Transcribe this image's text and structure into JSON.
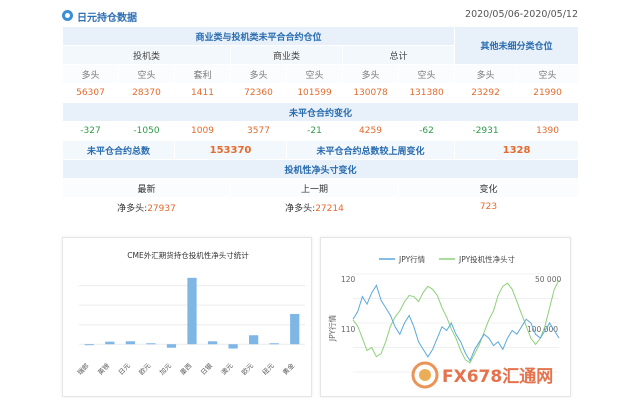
{
  "header": {
    "title": "日元持仓数据",
    "date_range": "2020/05/06-2020/05/12"
  },
  "table": {
    "main_header": "商业类与投机类未平合合约仓位",
    "other_header": "其他未细分类仓位",
    "group_spec": "投机类",
    "group_comm": "商业类",
    "group_total": "总计",
    "col_long": "多头",
    "col_short": "空头",
    "col_spread": "套利",
    "row1": [
      "56307",
      "28370",
      "1411",
      "72360",
      "101599",
      "130078",
      "131380",
      "23292",
      "21990"
    ],
    "change_header": "未平仓合约变化",
    "row2": [
      "-327",
      "-1050",
      "1009",
      "3577",
      "-21",
      "4259",
      "-62",
      "-2931",
      "1390"
    ],
    "total_label": "未平仓合约总数",
    "total_value": "153370",
    "weekly_label": "未平仓合约总数较上周变化",
    "weekly_value": "1328",
    "spec_header": "投机性净头寸变化",
    "latest_label": "最新",
    "prev_label": "上一期",
    "change_label": "变化",
    "net_long_label": "净多头:",
    "latest_value": "27937",
    "prev_value": "27214",
    "change_value": "723"
  },
  "bar_chart": {
    "title": "CME外汇期货持仓投机性净头寸统计",
    "color": "#7eb6e6"
  },
  "line_chart": {
    "legend_jpy": "JPY行情",
    "legend_pos": "JPY投机性净头寸",
    "ylabel": "JPY行情",
    "y_left_top": "120",
    "y_left_mid": "110",
    "y_right_top": "50 000",
    "y_right_mid": "100 000",
    "jpy_color": "#5aa9dc",
    "pos_color": "#8ed07a"
  },
  "watermark": {
    "text": "FX678汇通网"
  },
  "chart_data": [
    {
      "type": "bar",
      "title": "CME外汇期货持仓投机性净头寸统计",
      "categories": [
        "瑞郎",
        "英镑",
        "日元",
        "欧元",
        "加元",
        "墨西",
        "日银",
        "澳元",
        "欧元",
        "纽元",
        "黄金"
      ],
      "values": [
        0,
        1.3,
        1.5,
        0.5,
        -1.8,
        34,
        1.5,
        -2.2,
        4.6,
        0.5,
        15.5
      ],
      "ylim": [
        -5,
        38
      ]
    },
    {
      "type": "line",
      "series": [
        {
          "name": "JPY行情",
          "axis": "left",
          "values": [
            112,
            114,
            118,
            116,
            119,
            121,
            117,
            115,
            113,
            110,
            108,
            111,
            113,
            110,
            106,
            104,
            102,
            104,
            107,
            110,
            109,
            111,
            108,
            106,
            103,
            101,
            104,
            106,
            108,
            107,
            105,
            106,
            104,
            107,
            109,
            108,
            110,
            112,
            111,
            108,
            107,
            109,
            111,
            109,
            107
          ]
        },
        {
          "name": "JPY投机性净头寸",
          "axis": "right",
          "values": [
            -10000,
            -20000,
            -40000,
            -60000,
            -55000,
            -70000,
            -65000,
            -45000,
            -20000,
            -5000,
            5000,
            20000,
            30000,
            28000,
            20000,
            35000,
            45000,
            40000,
            30000,
            10000,
            -5000,
            -25000,
            -40000,
            -60000,
            -75000,
            -80000,
            -65000,
            -50000,
            -30000,
            -10000,
            5000,
            30000,
            45000,
            50000,
            40000,
            20000,
            0,
            -20000,
            -40000,
            -50000,
            -40000,
            -20000,
            10000,
            40000,
            55000
          ]
        }
      ]
    }
  ]
}
